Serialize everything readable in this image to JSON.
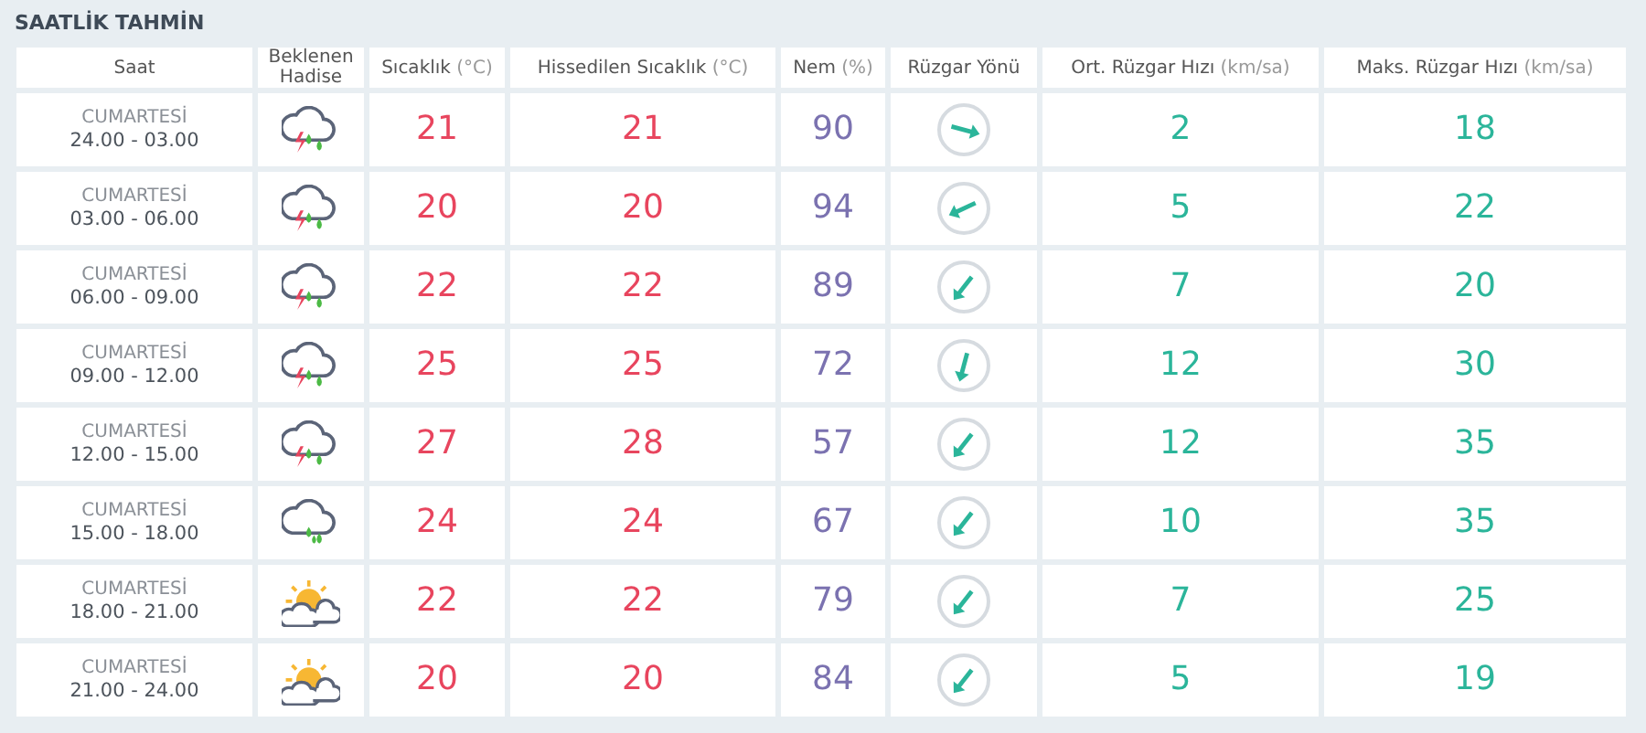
{
  "title": "SAATLİK TAHMİN",
  "columns": [
    {
      "label": "Saat"
    },
    {
      "label": "Beklenen Hadise"
    },
    {
      "label": "Sıcaklık",
      "unit": "(°C)"
    },
    {
      "label": "Hissedilen Sıcaklık",
      "unit": "(°C)"
    },
    {
      "label": "Nem",
      "unit": "(%)"
    },
    {
      "label": "Rüzgar Yönü"
    },
    {
      "label": "Ort. Rüzgar Hızı",
      "unit": "(km/sa)"
    },
    {
      "label": "Maks. Rüzgar Hızı",
      "unit": "(km/sa)"
    }
  ],
  "rows": [
    {
      "day": "CUMARTESİ",
      "hours": "24.00 - 03.00",
      "kind": "thunder-rain",
      "temp": "21",
      "feels": "21",
      "humidity": "90",
      "wind": {
        "kind": "east-southeast"
      },
      "wind_avg": "2",
      "wind_max": "18"
    },
    {
      "day": "CUMARTESİ",
      "hours": "03.00 - 06.00",
      "kind": "thunder-rain",
      "temp": "20",
      "feels": "20",
      "humidity": "94",
      "wind": {
        "kind": "west-southwest"
      },
      "wind_avg": "5",
      "wind_max": "22"
    },
    {
      "day": "CUMARTESİ",
      "hours": "06.00 - 09.00",
      "kind": "thunder-rain",
      "temp": "22",
      "feels": "22",
      "humidity": "89",
      "wind": {
        "kind": "southwest"
      },
      "wind_avg": "7",
      "wind_max": "20"
    },
    {
      "day": "CUMARTESİ",
      "hours": "09.00 - 12.00",
      "kind": "thunder-rain",
      "temp": "25",
      "feels": "25",
      "humidity": "72",
      "wind": {
        "kind": "south-southwest"
      },
      "wind_avg": "12",
      "wind_max": "30"
    },
    {
      "day": "CUMARTESİ",
      "hours": "12.00 - 15.00",
      "kind": "thunder-rain",
      "temp": "27",
      "feels": "28",
      "humidity": "57",
      "wind": {
        "kind": "southwest"
      },
      "wind_avg": "12",
      "wind_max": "35"
    },
    {
      "day": "CUMARTESİ",
      "hours": "15.00 - 18.00",
      "kind": "rain",
      "temp": "24",
      "feels": "24",
      "humidity": "67",
      "wind": {
        "kind": "southwest"
      },
      "wind_avg": "10",
      "wind_max": "35"
    },
    {
      "day": "CUMARTESİ",
      "hours": "18.00 - 21.00",
      "kind": "partly-cloudy",
      "temp": "22",
      "feels": "22",
      "humidity": "79",
      "wind": {
        "kind": "southwest"
      },
      "wind_avg": "7",
      "wind_max": "25"
    },
    {
      "day": "CUMARTESİ",
      "hours": "21.00 - 24.00",
      "kind": "partly-cloudy",
      "temp": "20",
      "feels": "20",
      "humidity": "84",
      "wind": {
        "kind": "southwest"
      },
      "wind_avg": "5",
      "wind_max": "19"
    }
  ]
}
